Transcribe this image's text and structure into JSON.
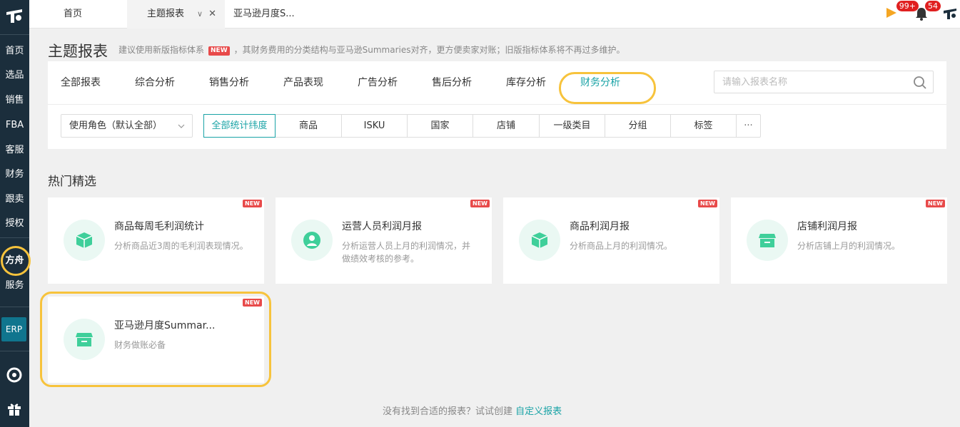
{
  "sidebar": {
    "items": [
      "首页",
      "选品",
      "销售",
      "FBA",
      "客服",
      "财务",
      "跟卖",
      "授权",
      "方舟",
      "服务"
    ],
    "erp_label": "ERP"
  },
  "topbar": {
    "tabs": [
      {
        "label": "首页"
      },
      {
        "label": "主题报表"
      },
      {
        "label": "亚马逊月度S..."
      }
    ],
    "flag_badge": "99+",
    "bell_badge": "54"
  },
  "header": {
    "title": "主题报表",
    "notice_before": "建议使用新版指标体系",
    "new_tag": "NEW",
    "notice_after": "，其财务费用的分类结构与亚马逊Summaries对齐，更方便卖家对账；旧版指标体系将不再过多维护。"
  },
  "categories": [
    "全部报表",
    "综合分析",
    "销售分析",
    "产品表现",
    "广告分析",
    "售后分析",
    "库存分析",
    "财务分析"
  ],
  "active_category": "财务分析",
  "search": {
    "placeholder": "请输入报表名称"
  },
  "role_select": {
    "value": "使用角色（默认全部）"
  },
  "dimensions": [
    "全部统计纬度",
    "商品",
    "ISKU",
    "国家",
    "店铺",
    "一级类目",
    "分组",
    "标签",
    "···"
  ],
  "section_title": "热门精选",
  "cards": [
    {
      "title": "商品每周毛利润统计",
      "desc": "分析商品近3周的毛利润表现情况。",
      "icon": "box-icon",
      "tag": "NEW"
    },
    {
      "title": "运营人员利润月报",
      "desc": "分析运营人员上月的利润情况，并做绩效考核的参考。",
      "icon": "person-icon",
      "tag": "NEW"
    },
    {
      "title": "商品利润月报",
      "desc": "分析商品上月的利润情况。",
      "icon": "box-icon",
      "tag": "NEW"
    },
    {
      "title": "店铺利润月报",
      "desc": "分析店铺上月的利润情况。",
      "icon": "store-icon",
      "tag": "NEW"
    },
    {
      "title": "亚马逊月度Summar...",
      "desc": "财务做账必备",
      "icon": "store-icon",
      "tag": "NEW"
    }
  ],
  "footer": {
    "text": "没有找到合适的报表？试试创建",
    "link": "自定义报表"
  },
  "colors": {
    "accent": "#1aa3a6",
    "sidebar": "#1b2e3c",
    "highlight": "#f7c33c",
    "new": "#e84a4a",
    "icon_green": "#3fcf9a"
  }
}
